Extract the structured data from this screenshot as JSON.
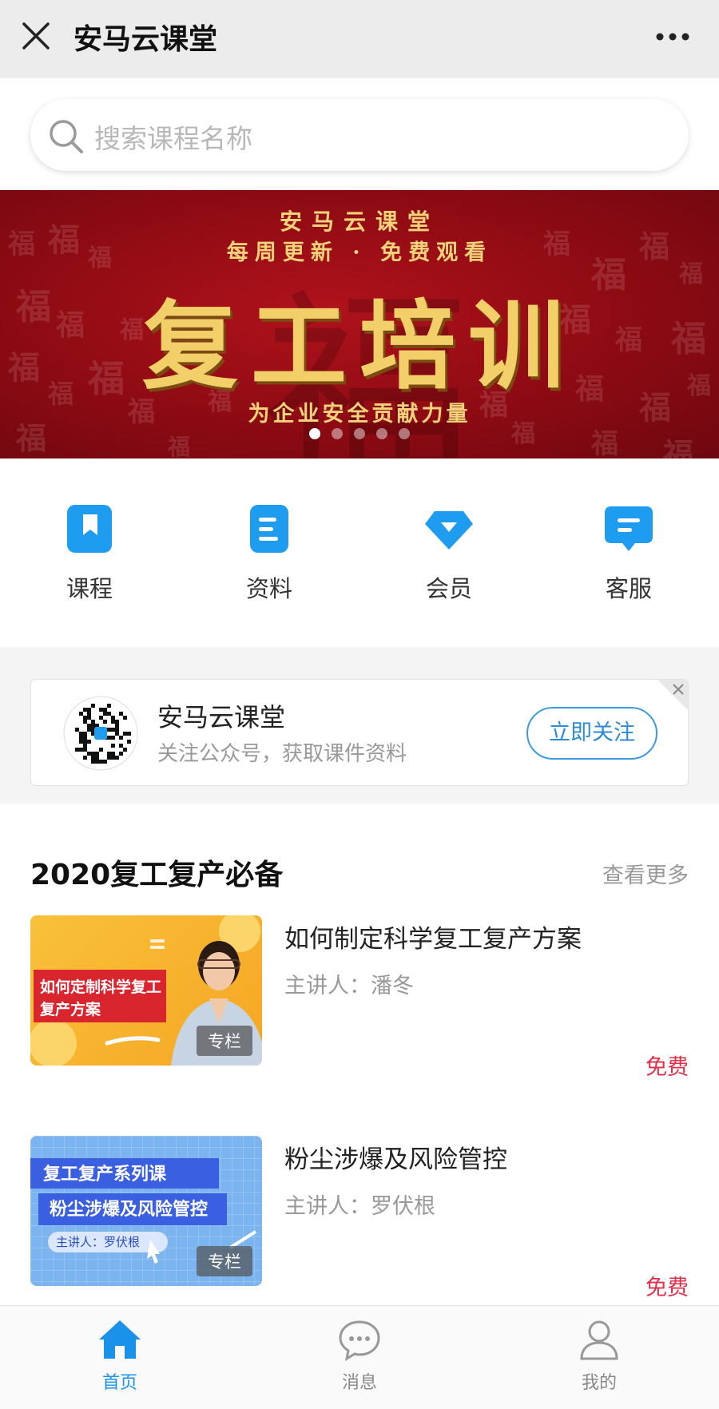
{
  "header": {
    "title": "安马云课堂",
    "close_icon": "close-icon",
    "more_icon": "more-dots-icon"
  },
  "search": {
    "placeholder": "搜索课程名称",
    "icon": "search-icon"
  },
  "banner": {
    "title": "安马云课堂",
    "subtitle": "每周更新 · 免费观看",
    "headline": "复工培训",
    "slogan": "为企业安全贡献力量",
    "background_glyph": "福",
    "slide_count": 5,
    "active_slide": 1,
    "colors": {
      "background": "#9e0f18",
      "text": "#f3cf6a"
    }
  },
  "quick_nav": [
    {
      "label": "课程",
      "icon": "bookmark-icon"
    },
    {
      "label": "资料",
      "icon": "document-icon"
    },
    {
      "label": "会员",
      "icon": "diamond-icon"
    },
    {
      "label": "客服",
      "icon": "chat-bubble-icon"
    }
  ],
  "follow_card": {
    "name": "安马云课堂",
    "description": "关注公众号，获取课件资料",
    "button_label": "立即关注",
    "qr_icon": "qr-code-icon",
    "close_icon": "close-icon"
  },
  "section": {
    "title": "2020复工复产必备",
    "more_label": "查看更多",
    "courses": [
      {
        "title": "如何制定科学复工复产方案",
        "lecturer": "主讲人：潘冬",
        "price": "免费",
        "tag": "专栏",
        "thumb_text_line1": "如何定制科学复工",
        "thumb_text_line2": "复产方案"
      },
      {
        "title": "粉尘涉爆及风险管控",
        "lecturer": "主讲人：罗伏根",
        "price": "免费",
        "tag": "专栏",
        "thumb_text_line1": "复工复产系列课",
        "thumb_text_line2": "粉尘涉爆及风险管控",
        "thumb_text_line3": "主讲人：罗伏根"
      }
    ]
  },
  "tabbar": [
    {
      "label": "首页",
      "icon": "home-icon",
      "active": true
    },
    {
      "label": "消息",
      "icon": "message-icon",
      "active": false
    },
    {
      "label": "我的",
      "icon": "user-icon",
      "active": false
    }
  ],
  "colors": {
    "accent": "#1a92ea",
    "price": "#e0314b",
    "follow_button": "#3b9be0"
  }
}
